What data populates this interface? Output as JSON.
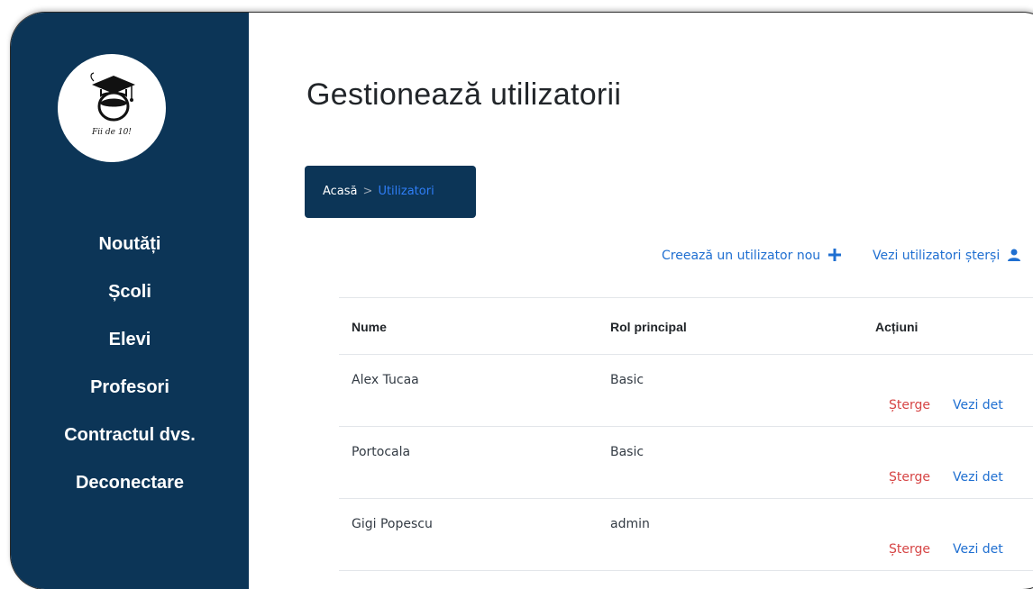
{
  "sidebar": {
    "logo_text": "Fii de 10!",
    "items": [
      {
        "label": "Noutăți"
      },
      {
        "label": "Școli"
      },
      {
        "label": "Elevi"
      },
      {
        "label": "Profesori"
      },
      {
        "label": "Contractul dvs."
      },
      {
        "label": "Deconectare"
      }
    ]
  },
  "header": {
    "title": "Gestionează utilizatorii"
  },
  "breadcrumb": {
    "home": "Acasă",
    "separator": ">",
    "current": "Utilizatori"
  },
  "actions": {
    "create_label": "Creează un utilizator nou",
    "create_icon": "plus-icon",
    "deleted_label": "Vezi utilizatori șterși",
    "deleted_icon": "user-icon"
  },
  "table": {
    "columns": [
      "Nume",
      "Rol principal",
      "Acțiuni"
    ],
    "rows": [
      {
        "name": "Alex Tucaa",
        "role": "Basic",
        "delete": "Șterge",
        "view": "Vezi det"
      },
      {
        "name": "Portocala",
        "role": "Basic",
        "delete": "Șterge",
        "view": "Vezi det"
      },
      {
        "name": "Gigi Popescu",
        "role": "admin",
        "delete": "Șterge",
        "view": "Vezi det"
      }
    ]
  },
  "colors": {
    "sidebar_bg": "#0c3557",
    "link": "#1f6fd1",
    "danger": "#d64545",
    "breadcrumb_current": "#2f7ef7"
  }
}
